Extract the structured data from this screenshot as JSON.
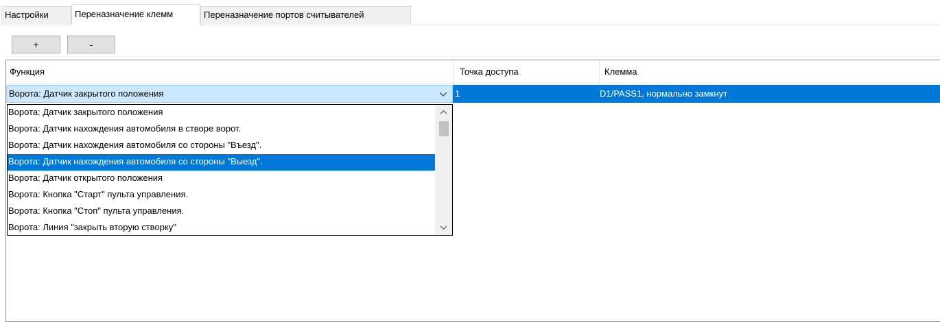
{
  "tabs": [
    {
      "label": "Настройки",
      "active": false
    },
    {
      "label": "Переназначение клемм",
      "active": true
    },
    {
      "label": "Переназначение портов считывателей",
      "active": false
    }
  ],
  "toolbar": {
    "add_label": "+",
    "remove_label": "-"
  },
  "grid": {
    "columns": [
      "Функция",
      "Точка доступа",
      "Клемма"
    ],
    "row": {
      "function": "Ворота: Датчик закрытого положения",
      "access_point": "1",
      "terminal": "D1/PASS1, нормально замкнут"
    }
  },
  "dropdown": {
    "options": [
      "Ворота: Датчик закрытого положения",
      "Ворота: Датчик нахождения автомобиля в створе ворот.",
      "Ворота: Датчик нахождения автомобиля со стороны \"Въезд\".",
      "Ворота: Датчик нахождения автомобиля со стороны \"Выезд\".",
      "Ворота: Датчик открытого положения",
      "Ворота: Кнопка \"Старт\" пульта управления.",
      "Ворота: Кнопка \"Стоп\" пульта управления.",
      "Ворота: Линия \"закрыть вторую створку\""
    ],
    "highlighted_index": 3
  },
  "colors": {
    "selection": "#0078d7",
    "combo_bg": "#cce8ff"
  }
}
